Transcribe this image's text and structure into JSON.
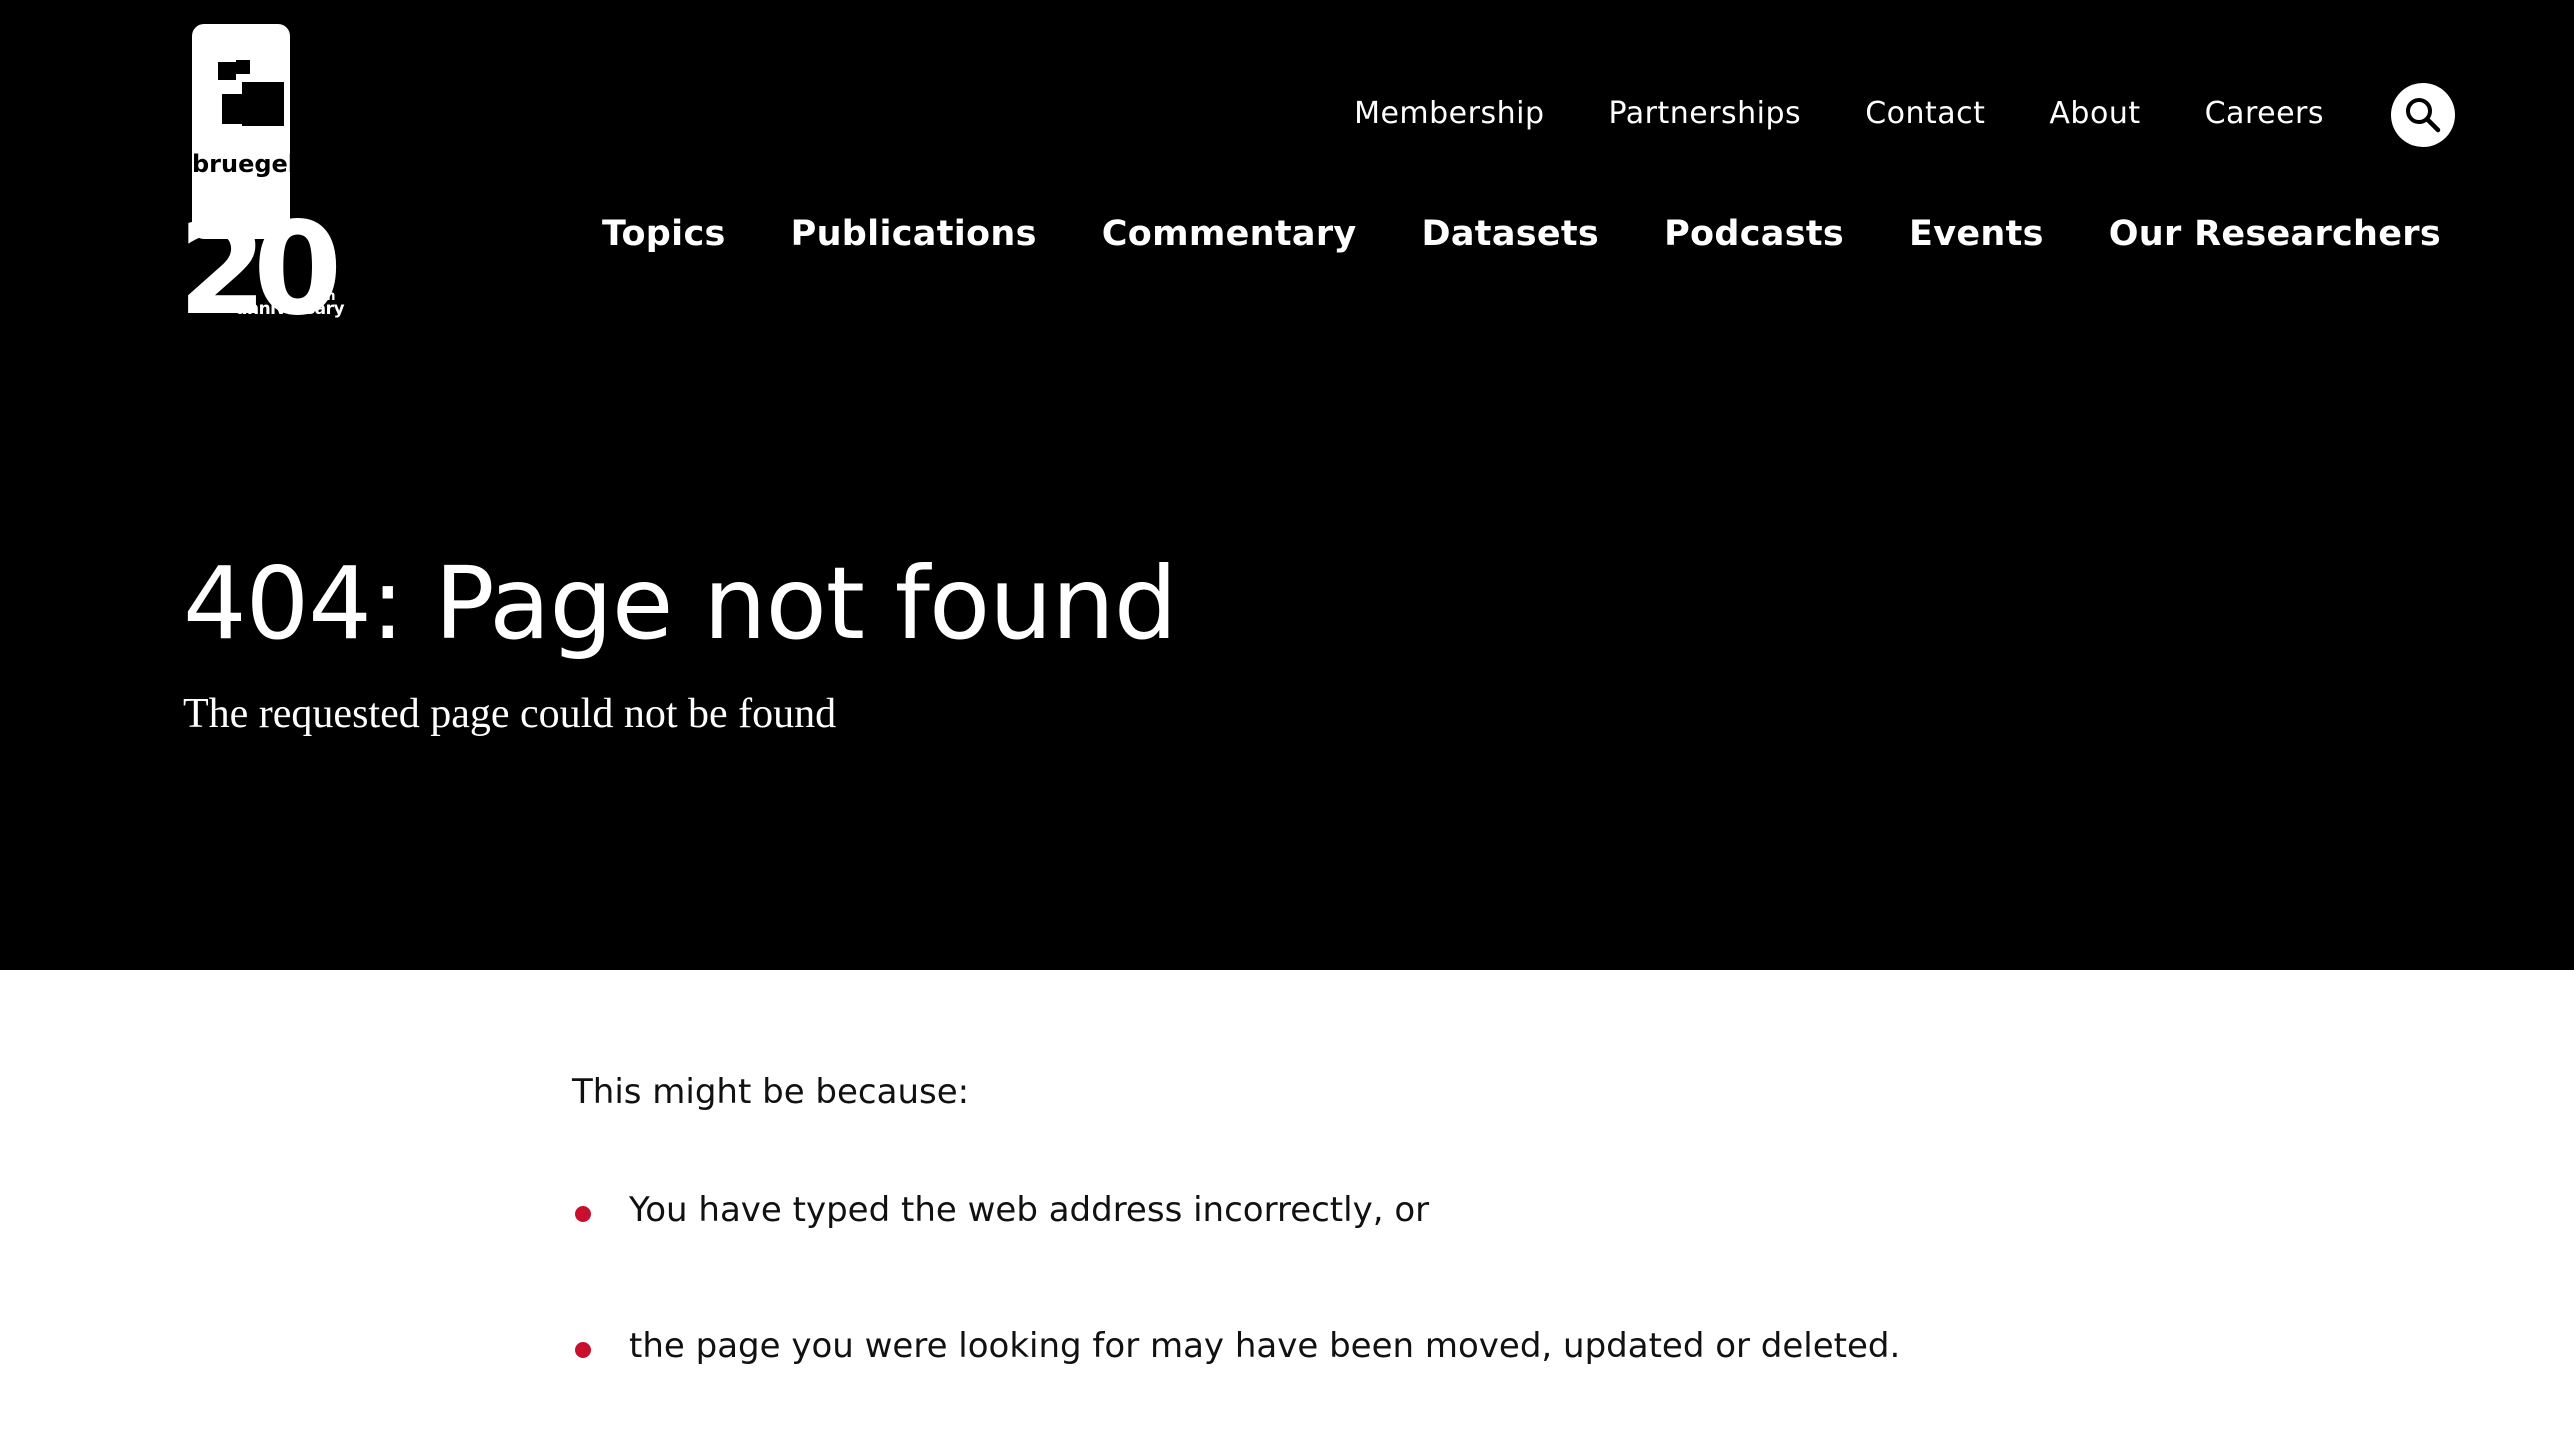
{
  "header": {
    "logo": {
      "brand": "bruegel",
      "anniversary_number": "20",
      "anniversary_suffix": "th",
      "anniversary_word": "anniversary"
    },
    "utility_nav": [
      "Membership",
      "Partnerships",
      "Contact",
      "About",
      "Careers"
    ],
    "search_icon": "search-icon",
    "main_nav": [
      "Topics",
      "Publications",
      "Commentary",
      "Datasets",
      "Podcasts",
      "Events",
      "Our Researchers"
    ]
  },
  "hero": {
    "title": "404: Page not found",
    "subtitle": "The requested page could not be found"
  },
  "content": {
    "intro": "This might be because:",
    "reasons": [
      "You have typed the web address incorrectly, or",
      "the page you were looking for may have been moved, updated or deleted."
    ]
  },
  "colors": {
    "hero_background": "#000000",
    "bullet_accent": "#c8102e",
    "body_text": "#111111"
  }
}
